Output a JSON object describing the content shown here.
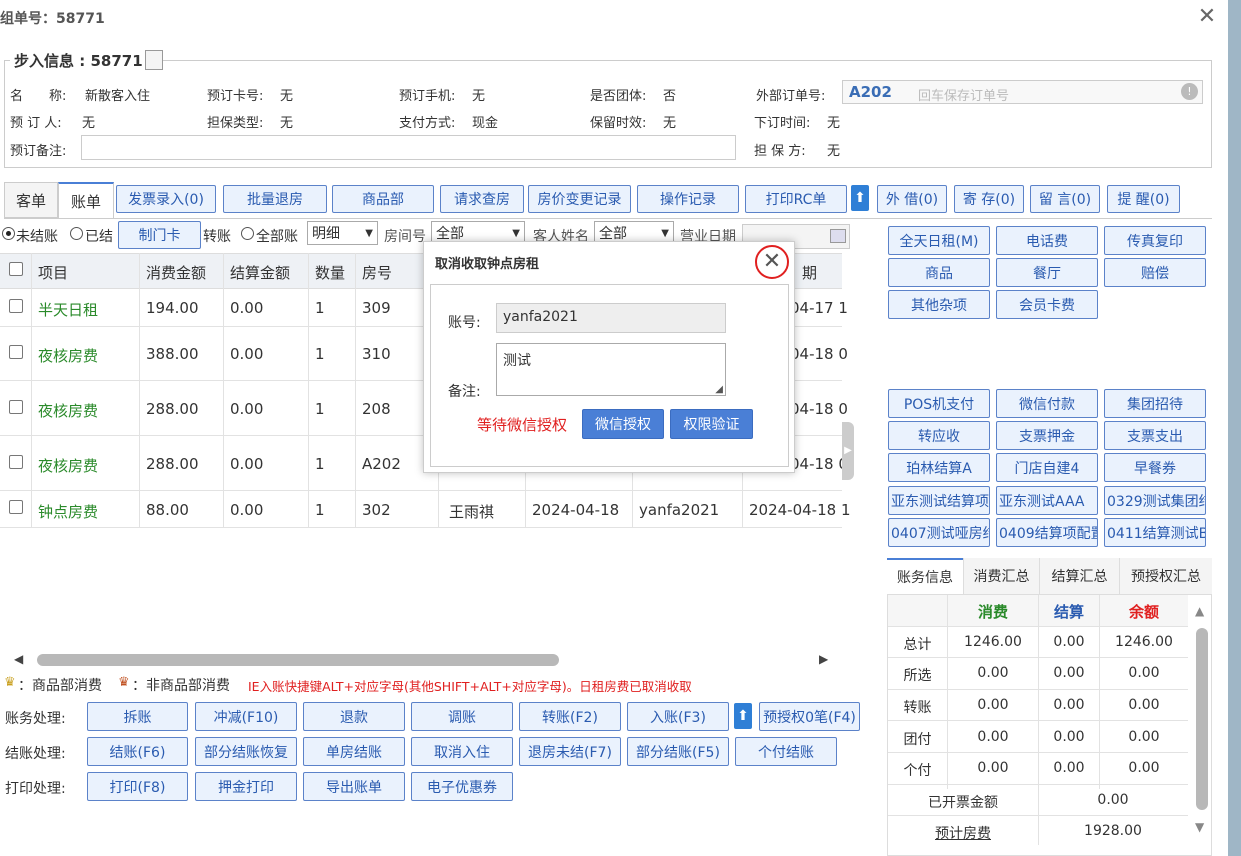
{
  "title": "组单号：58771",
  "info": {
    "heading": "步入信息 : 58771",
    "name_label": "名　　称:",
    "name_value": "新散客入住",
    "card_label": "预订卡号:",
    "card_value": "无",
    "phone_label": "预订手机:",
    "phone_value": "无",
    "group_label": "是否团体:",
    "group_value": "否",
    "ext_label": "外部订单号:",
    "ext_value": "A202",
    "ext_placeholder": "回车保存订单号",
    "booker_label": "预 订 人:",
    "booker_value": "无",
    "guar_type_label": "担保类型:",
    "guar_type_value": "无",
    "pay_label": "支付方式:",
    "pay_value": "现金",
    "keep_label": "保留时效:",
    "keep_value": "无",
    "order_time_label": "下订时间:",
    "order_time_value": "无",
    "remark_label": "预订备注:",
    "guar_label": "担 保 方:",
    "guar_value": "无"
  },
  "tabs": [
    "客单",
    "账单"
  ],
  "toolbar": [
    "发票录入(0)",
    "批量退房",
    "商品部",
    "请求查房",
    "房价变更记录",
    "操作记录",
    "打印RC单",
    "外 借(0)",
    "寄 存(0)",
    "留 言(0)",
    "提 醒(0)"
  ],
  "filter": {
    "r1": "未结账",
    "r2": "已结",
    "make_card": "制门卡",
    "r3": "转账",
    "r4": "全部账",
    "detail": "明细",
    "room_label": "房间号",
    "room_value": "全部",
    "guest_label": "客人姓名",
    "guest_value": "全部",
    "date_label": "营业日期"
  },
  "table": {
    "headers": [
      "项目",
      "消费金额",
      "结算金额",
      "数量",
      "房号",
      "期"
    ],
    "rows": [
      {
        "item": "半天日租",
        "amount": "194.00",
        "settled": "0.00",
        "qty": "1",
        "room": "309",
        "guest": "",
        "date": "",
        "op": "",
        "time": "04-17 1"
      },
      {
        "item": "夜核房费",
        "amount": "388.00",
        "settled": "0.00",
        "qty": "1",
        "room": "310",
        "guest": "",
        "date": "",
        "op": "",
        "time": "04-18 0"
      },
      {
        "item": "夜核房费",
        "amount": "288.00",
        "settled": "0.00",
        "qty": "1",
        "room": "208",
        "guest": "",
        "date": "",
        "op": "",
        "time": "04-18 0"
      },
      {
        "item": "夜核房费",
        "amount": "288.00",
        "settled": "0.00",
        "qty": "1",
        "room": "A202",
        "guest": "",
        "date": "",
        "op": "",
        "time": "04-18 0"
      },
      {
        "item": "钟点房费",
        "amount": "88.00",
        "settled": "0.00",
        "qty": "1",
        "room": "302",
        "guest": "王雨祺",
        "date": "2024-04-18",
        "op": "yanfa2021",
        "time": "2024-04-18 1"
      }
    ]
  },
  "legend": {
    "a": "：商品部消费",
    "b": "：非商品部消费",
    "note": "IE入账快捷键ALT+对应字母(其他SHIFT+ALT+对应字母)。日租房费已取消收取"
  },
  "actions": {
    "acct_label": "账务处理:",
    "acct": [
      "拆账",
      "冲减(F10)",
      "退款",
      "调账",
      "转账(F2)",
      "入账(F3)",
      "预授权0笔(F4)"
    ],
    "settle_label": "结账处理:",
    "settle": [
      "结账(F6)",
      "部分结账恢复",
      "单房结账",
      "取消入住",
      "退房未结(F7)",
      "部分结账(F5)",
      "个付结账"
    ],
    "print_label": "打印处理:",
    "print": [
      "打印(F8)",
      "押金打印",
      "导出账单",
      "电子优惠券"
    ]
  },
  "right_top": [
    "全天日租(M)",
    "电话费",
    "传真复印",
    "商品",
    "餐厅",
    "赔偿",
    "其他杂项",
    "会员卡费"
  ],
  "right_pay": [
    "POS机支付",
    "微信付款",
    "集团招待",
    "转应收",
    "支票押金",
    "支票支出",
    "珀林结算A",
    "门店自建4",
    "早餐券",
    "亚东测试结算项",
    "亚东测试AAA",
    "0329测试集团结",
    "0407测试哑房结",
    "0409结算项配置",
    "0411结算测试B"
  ],
  "summary": {
    "tabs": [
      "账务信息",
      "消费汇总",
      "结算汇总",
      "预授权汇总"
    ],
    "h_consume": "消费",
    "h_settle": "结算",
    "h_balance": "余额",
    "rows": [
      {
        "label": "总计",
        "c": "1246.00",
        "s": "0.00",
        "b": "1246.00"
      },
      {
        "label": "所选",
        "c": "0.00",
        "s": "0.00",
        "b": "0.00"
      },
      {
        "label": "转账",
        "c": "0.00",
        "s": "0.00",
        "b": "0.00"
      },
      {
        "label": "团付",
        "c": "0.00",
        "s": "0.00",
        "b": "0.00"
      },
      {
        "label": "个付",
        "c": "0.00",
        "s": "0.00",
        "b": "0.00"
      }
    ],
    "invoiced_label": "已开票金额",
    "invoiced_value": "0.00",
    "est_label": "预计房费",
    "est_value": "1928.00"
  },
  "modal": {
    "title": "取消收取钟点房租",
    "account_label": "账号:",
    "account_value": "yanfa2021",
    "remark_label": "备注:",
    "remark_value": "测试",
    "status": "等待微信授权",
    "wechat_btn": "微信授权",
    "verify_btn": "权限验证"
  },
  "colors": {
    "accent": "#4a7fd6",
    "green": "#2a8a2a",
    "red": "#e02020"
  }
}
